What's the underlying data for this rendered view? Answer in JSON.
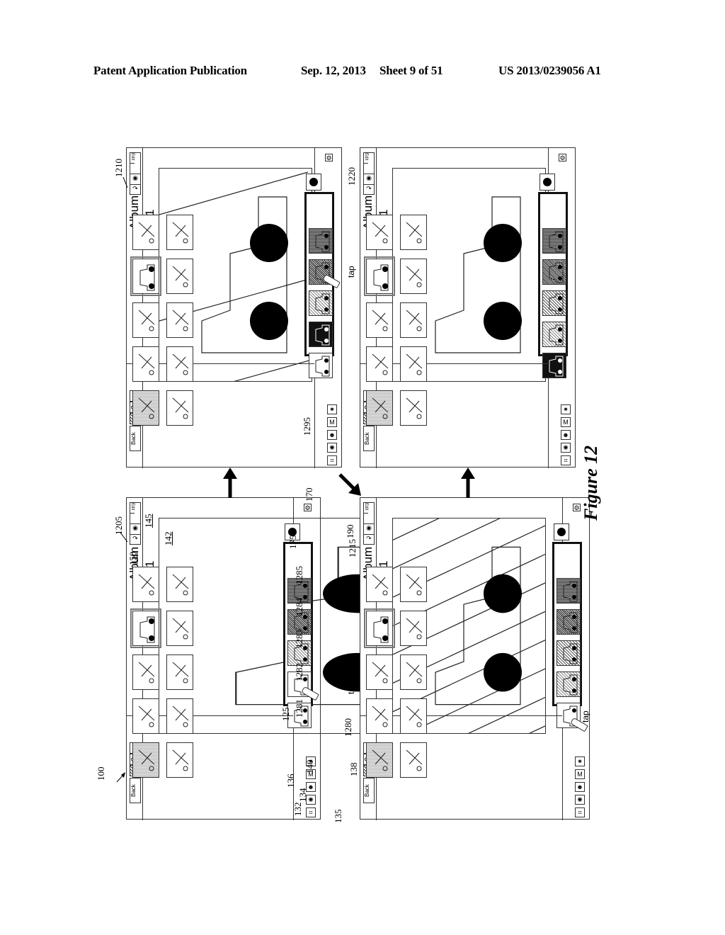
{
  "header": {
    "publication": "Patent Application Publication",
    "date": "Sep. 12, 2013",
    "sheet": "Sheet 9 of 51",
    "number": "US 2013/0239056 A1"
  },
  "figure_label": "Figure 12",
  "panels": [
    {
      "id": "1205",
      "stage": "initial",
      "title": "Album 1",
      "back_label": "Back",
      "help_label": "?",
      "overlay": "none",
      "tap_target": "effect 1282"
    },
    {
      "id": "1210",
      "stage": "partial effect preview",
      "title": "Album 1",
      "back_label": "Back",
      "help_label": "?",
      "overlay": "sparse diagonal lines",
      "tap_target": "effect 2"
    },
    {
      "id": "1215",
      "stage": "effect applied",
      "title": "Album 1",
      "back_label": "Back",
      "help_label": "?",
      "overlay": "dense diagonal lines",
      "tap_target": "effect 1"
    },
    {
      "id": "1220",
      "stage": "effect removed",
      "title": "Album 1",
      "back_label": "Back",
      "help_label": "?",
      "overlay": "none",
      "tap_target": ""
    }
  ],
  "refs": {
    "r100": "100",
    "r1205": "1205",
    "r150": "150",
    "r145": "145",
    "r142": "142",
    "r175": "175",
    "r190": "190",
    "r1285": "1285",
    "r1284": "1284",
    "r1283": "1283",
    "r1282": "1282",
    "r1281": "1281",
    "r1280": "1280",
    "r125": "125",
    "r140": "140",
    "r138": "138",
    "r136": "136",
    "r134": "134",
    "r132": "132",
    "r135": "135",
    "r170": "170",
    "r1215": "1215",
    "r1210": "1210",
    "r1220": "1220",
    "r1295": "1295"
  },
  "tap_label": "tap",
  "icons": {
    "toolbar_tools": [
      "crop-tool",
      "red-eye-tool",
      "face-tool",
      "brush-tool",
      "effects-tool"
    ],
    "thumbnails": [
      "person-with-sign",
      "person-on-beach",
      "clouds",
      "bicycle",
      "person-with-frame",
      "group-of-people",
      "gradient-spray",
      "car",
      "person-on-bike",
      "lightning"
    ],
    "effects": [
      "effect-1281",
      "effect-1282",
      "effect-1283",
      "effect-1284",
      "effect-1285"
    ]
  }
}
